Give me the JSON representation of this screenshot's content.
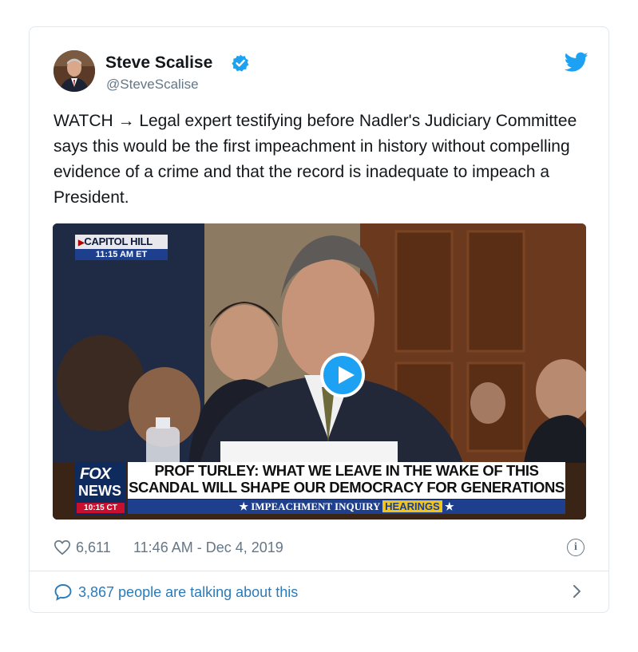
{
  "tweet": {
    "display_name": "Steve Scalise",
    "handle": "@SteveScalise",
    "text": "WATCH → Legal expert testifying before Nadler's Judiciary Committee says this would be the first impeachment in history without compelling evidence of a crime and that the record is inadequate to impeach a President.",
    "likes": "6,611",
    "timestamp": "11:46 AM - Dec 4, 2019",
    "conversation": "3,867 people are talking about this"
  },
  "video": {
    "location_bug": "CAPITOL HILL",
    "location_time": "11:15 AM ET",
    "network_line1": "FOX",
    "network_line2": "NEWS",
    "network_time": "10:15 CT",
    "headline_line1": "PROF TURLEY: WHAT WE LEAVE IN THE WAKE OF THIS",
    "headline_line2": "SCANDAL WILL SHAPE OUR DEMOCRACY FOR GENERATIONS",
    "ticker_left": "★ IMPEACHMENT INQUIRY",
    "ticker_highlight": "HEARINGS",
    "ticker_right": "★"
  },
  "icons": {
    "verified": "verified-badge-icon",
    "bird": "twitter-bird-icon",
    "heart": "heart-icon",
    "info": "info-icon",
    "bubble": "speech-bubble-icon",
    "chevron": "chevron-right-icon",
    "play": "play-icon"
  },
  "colors": {
    "twitter_blue": "#1da1f2",
    "link_blue": "#2b7bb9",
    "muted_gray": "#657786",
    "border": "#e1e8ed"
  }
}
